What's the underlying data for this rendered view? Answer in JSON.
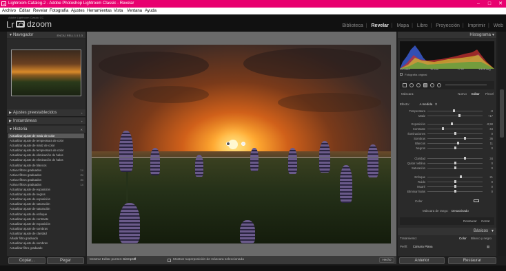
{
  "window": {
    "title": "Lightroom Catalog-2 - Adobe Photoshop Lightroom Classic - Revelar",
    "icon_label": "Lr"
  },
  "menu": [
    "Archivo",
    "Editar",
    "Revelar",
    "Fotografía",
    "Ajustes",
    "Herramientas",
    "Vista",
    "Ventana",
    "Ayuda"
  ],
  "identity": {
    "catalog": "Adobe Lightroom Classic CC",
    "logo": "Lr",
    "brand": "dzoom"
  },
  "modules": {
    "items": [
      "Biblioteca",
      "Revelar",
      "Mapa",
      "Libro",
      "Proyección",
      "Imprimir",
      "Web"
    ],
    "active": "Revelar"
  },
  "left": {
    "navigator": {
      "label": "Navegador",
      "options": [
        "ENCAJ",
        "RELL",
        "1:1",
        "1:3"
      ]
    },
    "presets_label": "Ajustes preestablecidos",
    "snapshots_label": "Instantáneas",
    "history_label": "Historia",
    "history": [
      {
        "label": "Actualizar ajuste de matiz de color",
        "tag": "",
        "selected": true
      },
      {
        "label": "Actualizar ajuste de temperatura de color",
        "tag": ""
      },
      {
        "label": "Actualizar ajuste de matiz de color",
        "tag": ""
      },
      {
        "label": "Actualizar ajuste de temperatura de color",
        "tag": ""
      },
      {
        "label": "Actualizar ajuste de eliminación de halos",
        "tag": ""
      },
      {
        "label": "Actualizar ajuste de eliminación de halos",
        "tag": ""
      },
      {
        "label": "Actualizar ajuste de blancos",
        "tag": ""
      },
      {
        "label": "Activar filtros graduados",
        "tag": "1x"
      },
      {
        "label": "Activar filtros graduados",
        "tag": "2x"
      },
      {
        "label": "Activar filtros graduados",
        "tag": "3x"
      },
      {
        "label": "Activar filtros graduados",
        "tag": "1x"
      },
      {
        "label": "Actualizar ajuste de exposición",
        "tag": ""
      },
      {
        "label": "Actualizar ajuste de negros",
        "tag": ""
      },
      {
        "label": "Actualizar ajuste de exposición",
        "tag": ""
      },
      {
        "label": "Actualizar ajuste de saturación",
        "tag": ""
      },
      {
        "label": "Actualizar ajuste de saturación",
        "tag": ""
      },
      {
        "label": "Actualizar ajuste de enfoque",
        "tag": ""
      },
      {
        "label": "Actualizar ajuste de contraste",
        "tag": ""
      },
      {
        "label": "Actualizar ajuste de exposición",
        "tag": ""
      },
      {
        "label": "Actualizar ajuste de sombras",
        "tag": ""
      },
      {
        "label": "Actualizar ajuste de claridad",
        "tag": ""
      },
      {
        "label": "Añadir filtro graduado",
        "tag": ""
      },
      {
        "label": "Actualizar ajuste de sombras",
        "tag": ""
      },
      {
        "label": "Actualizar filtro graduado",
        "tag": ""
      }
    ],
    "copy_button": "Copiar...",
    "paste_button": "Pegar"
  },
  "toolbar": {
    "edit_points_label": "Mostrar Editar puntos:",
    "edit_points_value": "Siempre",
    "overlay_label": "Mostrar superposición de máscara seleccionada",
    "done_button": "Hecho"
  },
  "right": {
    "histogram_label": "Histograma",
    "histo_info": [
      "ISO 640",
      "11 mm",
      "f / 22",
      "1/125 seg"
    ],
    "original_label": "Fotografía original",
    "mask_tabs": [
      "Máscara:",
      "Nuevo",
      "Editar",
      "Pincel"
    ],
    "effect_label": "Efecto :",
    "effect_value": "A medida",
    "sliders": [
      {
        "label": "Temperatura",
        "value": "-8",
        "pos": 0.47
      },
      {
        "label": "Matiz",
        "value": "+17",
        "pos": 0.58
      },
      {
        "label": "Exposición",
        "value": "-0,50",
        "pos": 0.44
      },
      {
        "label": "Contraste",
        "value": "-44",
        "pos": 0.28
      },
      {
        "label": "Iluminaciones",
        "value": "0",
        "pos": 0.5
      },
      {
        "label": "Sombras",
        "value": "36",
        "pos": 0.68
      },
      {
        "label": "Blancos",
        "value": "11",
        "pos": 0.55
      },
      {
        "label": "Negros",
        "value": "0",
        "pos": 0.5
      },
      {
        "label": "Claridad",
        "value": "34",
        "pos": 0.67
      },
      {
        "label": "Quitar neblina",
        "value": "0",
        "pos": 0.5
      },
      {
        "label": "Saturación",
        "value": "0",
        "pos": 0.5
      },
      {
        "label": "Enfoque",
        "value": "21",
        "pos": 0.6
      },
      {
        "label": "Ruido",
        "value": "0",
        "pos": 0.5
      },
      {
        "label": "Muaré",
        "value": "0",
        "pos": 0.5
      },
      {
        "label": "Eliminar halos",
        "value": "0",
        "pos": 0.5
      }
    ],
    "color_label": "Color",
    "range_mask_label": "Máscara de rango:",
    "range_mask_value": "Desactivado",
    "restore_label": "Restaurar",
    "close_label": "Cerrar",
    "basic_label": "Básicos",
    "treatment_label": "Tratamiento:",
    "treatment_options": [
      "Color",
      "Blanco y negro"
    ],
    "profile_label": "Perfil:",
    "profile_value": "Cámara Plana",
    "previous_button": "Anterior",
    "reset_button": "Restaurar"
  }
}
